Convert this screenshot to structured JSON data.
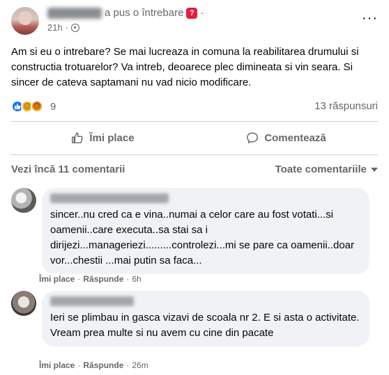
{
  "post": {
    "author_action": "a pus o întrebare",
    "time": "21h",
    "dot": "·",
    "question_icon": "question-mark-badge",
    "text": "Am si eu o intrebare? Se mai lucreaza in comuna la reabilitarea drumului si constructia trotuarelor? Va intreb, deoarece plec dimineata si vin seara. Si sincer de cateva saptamani nu vad nicio modificare.",
    "reactions_count": "9",
    "answers_count": "13 răspunsuri",
    "reaction_icons": [
      "like-icon",
      "sad-icon",
      "angry-icon"
    ]
  },
  "actions": {
    "like_label": "Îmi place",
    "comment_label": "Comentează"
  },
  "comments_section": {
    "view_more": "Vezi încă 11 comentarii",
    "sort_label": "Toate comentariile"
  },
  "comments": [
    {
      "text": "sincer..nu cred ca e vina..numai a celor care au fost votati...si oamenii..care executa..sa stai sa i dirijezi...manageriezi.........controlezi...mi se pare ca oamenii..doar vor...chestii ...mai putin sa faca...",
      "like_label": "Îmi place",
      "reply_label": "Răspunde",
      "time": "6h"
    },
    {
      "text": "Ieri se plimbau in gasca vizavi de scoala nr 2. E si asta o activitate. Vream prea multe si nu avem cu cine din pacate",
      "like_label": "Îmi place",
      "reply_label": "Răspunde",
      "time": "26m"
    }
  ],
  "colors": {
    "text": "#050505",
    "secondary": "#65676b",
    "bubble": "#f0f2f5",
    "accent": "#1877f2"
  }
}
